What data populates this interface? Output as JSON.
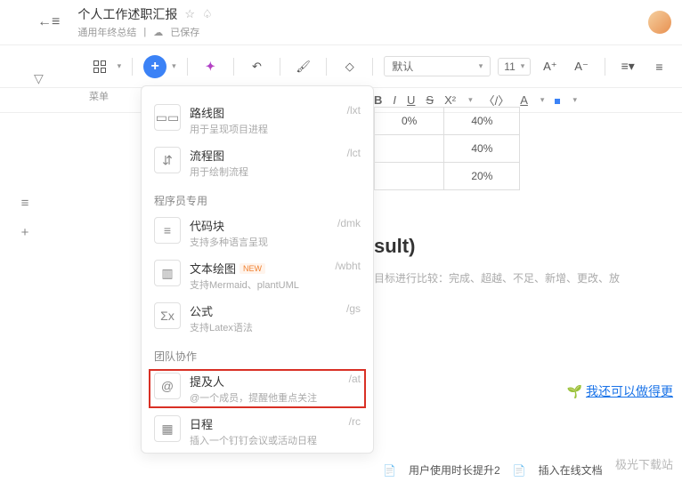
{
  "header": {
    "title": "个人工作述职汇报",
    "subtitle": "通用年终总结",
    "saved": "已保存"
  },
  "toolbar": {
    "menuLabel": "菜单",
    "fontDefault": "默认",
    "fontSize": "11",
    "aPlus": "A⁺",
    "aMinus": "A⁻",
    "bold": "B",
    "italic": "I",
    "underline": "U",
    "strike": "S",
    "superscript": "X²",
    "code": "〈/〉",
    "link": "A"
  },
  "dropdown": {
    "section1": "程序员专用",
    "section2": "团队协作",
    "items": [
      {
        "icon": "roadmap",
        "title": "路线图",
        "desc": "用于呈现项目进程",
        "shortcut": "/lxt"
      },
      {
        "icon": "flow",
        "title": "流程图",
        "desc": "用于绘制流程",
        "shortcut": "/lct"
      },
      {
        "icon": "code",
        "title": "代码块",
        "desc": "支持多种语言呈现",
        "shortcut": "/dmk"
      },
      {
        "icon": "textdraw",
        "title": "文本绘图",
        "desc": "支持Mermaid、plantUML",
        "shortcut": "/wbht",
        "badge": "NEW"
      },
      {
        "icon": "formula",
        "title": "公式",
        "desc": "支持Latex语法",
        "shortcut": "/gs"
      },
      {
        "icon": "mention",
        "title": "提及人",
        "desc": "@一个成员，提醒他重点关注",
        "shortcut": "/at"
      },
      {
        "icon": "calendar",
        "title": "日程",
        "desc": "插入一个钉钉会议或活动日程",
        "shortcut": "/rc"
      }
    ]
  },
  "content": {
    "table": [
      [
        "0%",
        "40%"
      ],
      [
        "",
        "40%"
      ],
      [
        "",
        "20%"
      ]
    ],
    "resultTitle": "sult)",
    "resultDesc": "目标进行比较：完成、超越、不足、新增、更改、放",
    "banner": "我还可以做得更",
    "bottom1": "用户使用时长提升2",
    "bottom2": "插入在线文档",
    "watermark": "极光下载站"
  }
}
